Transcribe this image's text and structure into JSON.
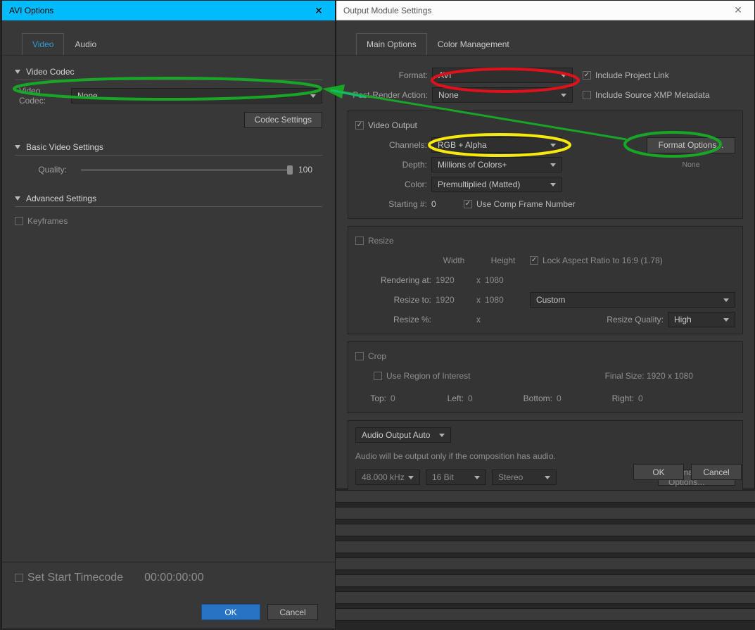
{
  "left": {
    "title": "AVI Options",
    "tabs": {
      "video": "Video",
      "audio": "Audio"
    },
    "video_codec_section": "Video Codec",
    "video_codec_label": "Video Codec:",
    "video_codec_value": "None",
    "codec_settings_btn": "Codec Settings",
    "basic_section": "Basic Video Settings",
    "quality_label": "Quality:",
    "quality_value": "100",
    "advanced_section": "Advanced Settings",
    "keyframes_label": "Keyframes",
    "start_timecode_label": "Set Start Timecode",
    "start_timecode_value": "00:00:00:00",
    "ok": "OK",
    "cancel": "Cancel"
  },
  "right": {
    "title": "Output Module Settings",
    "tabs": {
      "main": "Main Options",
      "color": "Color Management"
    },
    "format_label": "Format:",
    "format_value": "AVI",
    "include_project_link": "Include Project Link",
    "post_render_label": "Post-Render Action:",
    "post_render_value": "None",
    "include_xmp": "Include Source XMP Metadata",
    "video_output": "Video Output",
    "channels_label": "Channels:",
    "channels_value": "RGB + Alpha",
    "format_options_btn": "Format Options...",
    "depth_label": "Depth:",
    "depth_value": "Millions of Colors+",
    "none_note": "None",
    "color_label": "Color:",
    "color_value": "Premultiplied (Matted)",
    "starting_label": "Starting #:",
    "starting_value": "0",
    "use_comp_frame": "Use Comp Frame Number",
    "resize": {
      "title": "Resize",
      "width": "Width",
      "height": "Height",
      "lock_aspect": "Lock Aspect Ratio to 16:9 (1.78)",
      "rendering_at": "Rendering at:",
      "rendering_w": "1920",
      "rendering_h": "1080",
      "resize_to": "Resize to:",
      "resize_w": "1920",
      "resize_h": "1080",
      "custom": "Custom",
      "resize_pct": "Resize %:",
      "resize_quality_label": "Resize Quality:",
      "resize_quality_value": "High",
      "x": "x"
    },
    "crop": {
      "title": "Crop",
      "use_roi": "Use Region of Interest",
      "final_size": "Final Size: 1920 x 1080",
      "top": "Top:",
      "top_v": "0",
      "left": "Left:",
      "left_v": "0",
      "bottom": "Bottom:",
      "bottom_v": "0",
      "right": "Right:",
      "right_v": "0"
    },
    "audio": {
      "auto": "Audio Output Auto",
      "note": "Audio will be output only if the composition has audio.",
      "hz": "48.000 kHz",
      "bit": "16 Bit",
      "stereo": "Stereo",
      "format_options_btn": "Format Options..."
    },
    "ok": "OK",
    "cancel": "Cancel"
  }
}
